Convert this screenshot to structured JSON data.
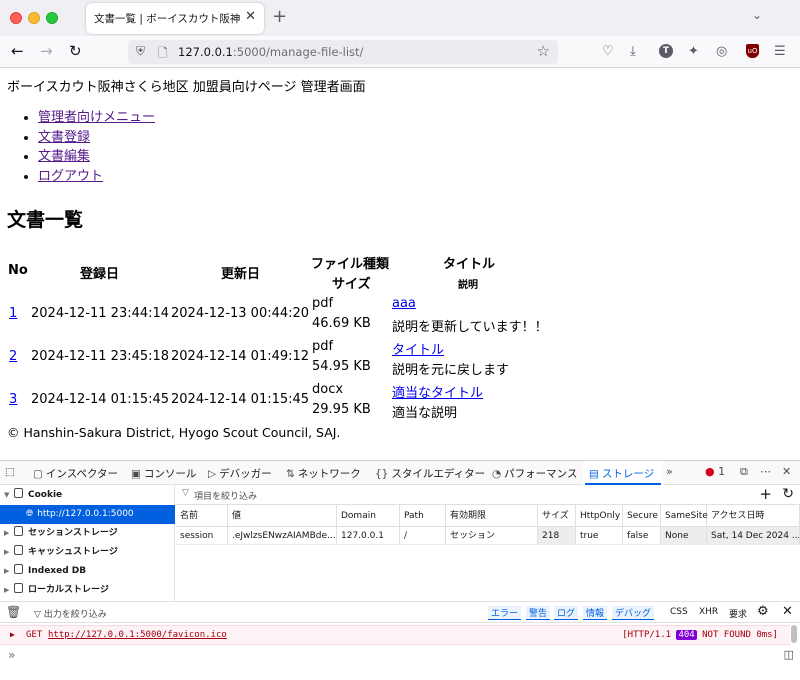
{
  "browser": {
    "tab_title": "文書一覧 | ボーイスカウト阪神さくら",
    "tab_close": "✕",
    "new_tab": "+",
    "tab_list": "⌄",
    "url_host": "127.0.0.1",
    "url_rest": ":5000/manage-file-list/",
    "back": "←",
    "forward": "→",
    "reload": "↻"
  },
  "page": {
    "header": "ボーイスカウト阪神さくら地区 加盟員向けページ 管理者画面",
    "menu": [
      "管理者向けメニュー",
      "文書登録",
      "文書編集",
      "ログアウト"
    ],
    "heading": "文書一覧",
    "table": {
      "headers": {
        "no": "No",
        "registered": "登録日",
        "updated": "更新日",
        "file_type": "ファイル種類",
        "size": "サイズ",
        "title": "タイトル",
        "description": "説明"
      },
      "rows": [
        {
          "no": "1",
          "registered": "2024-12-11 23:44:14",
          "updated": "2024-12-13 00:44:20",
          "type": "pdf",
          "size": "46.69 KB",
          "title": "aaa",
          "description": "説明を更新しています！！"
        },
        {
          "no": "2",
          "registered": "2024-12-11 23:45:18",
          "updated": "2024-12-14 01:49:12",
          "type": "pdf",
          "size": "54.95 KB",
          "title": "タイトル",
          "description": "説明を元に戻します"
        },
        {
          "no": "3",
          "registered": "2024-12-14 01:15:45",
          "updated": "2024-12-14 01:15:45",
          "type": "docx",
          "size": "29.95 KB",
          "title": "適当なタイトル",
          "description": "適当な説明"
        }
      ]
    },
    "footer": "© Hanshin-Sakura District, Hyogo Scout Council, SAJ."
  },
  "devtools": {
    "tabs": [
      "インスペクター",
      "コンソール",
      "デバッガー",
      "ネットワーク",
      "スタイルエディター",
      "パフォーマンス",
      "ストレージ"
    ],
    "more_tabs": "»",
    "error_count": "1",
    "storage_tree": {
      "cookie": "Cookie",
      "cookie_host": "http://127.0.0.1:5000",
      "session_storage": "セッションストレージ",
      "cache_storage": "キャッシュストレージ",
      "indexed_db": "Indexed DB",
      "local_storage": "ローカルストレージ"
    },
    "filter_placeholder": "項目を絞り込み",
    "columns": [
      "名前",
      "値",
      "Domain",
      "Path",
      "有効期限",
      "サイズ",
      "HttpOnly",
      "Secure",
      "SameSite",
      "アクセス日時"
    ],
    "cookie_row": [
      "session",
      ".eJwlzsENwzAIAMBde...",
      "127.0.0.1",
      "/",
      "セッション",
      "218",
      "true",
      "false",
      "None",
      "Sat, 14 Dec 2024 ..."
    ],
    "console": {
      "filter_placeholder": "出力を絞り込み",
      "levels": [
        "エラー",
        "警告",
        "ログ",
        "情報",
        "デバッグ"
      ],
      "extra_levels": [
        "CSS",
        "XHR",
        "要求"
      ],
      "message": {
        "method": "GET",
        "url": "http://127.0.0.1:5000/favicon.ico",
        "status_prefix": "[HTTP/1.1 ",
        "status_code": "404",
        "status_suffix": " NOT FOUND 0ms]"
      },
      "prompt": "»"
    }
  }
}
